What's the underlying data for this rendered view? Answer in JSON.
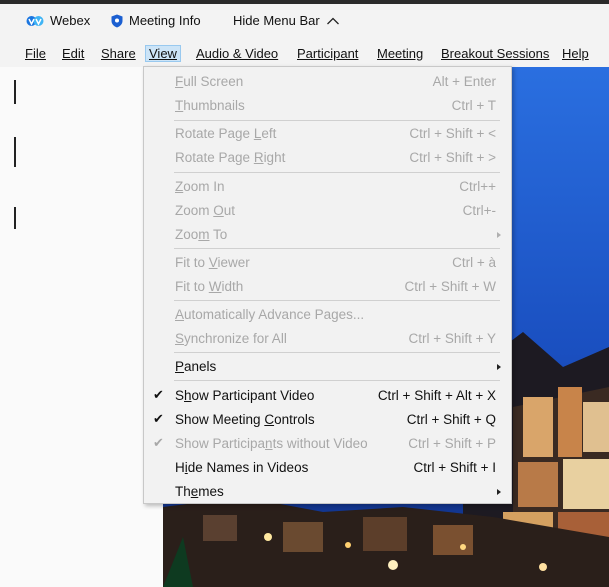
{
  "titlebar": {
    "app_name": "Webex",
    "meeting_info": "Meeting Info",
    "hide_menu_bar": "Hide Menu Bar"
  },
  "menubar": {
    "items": [
      "File",
      "Edit",
      "Share",
      "View",
      "Audio & Video",
      "Participant",
      "Meeting",
      "Breakout Sessions",
      "Help"
    ],
    "active": "View"
  },
  "view_menu": {
    "items": [
      {
        "pre": "",
        "u": "F",
        "post": "ull Screen",
        "shortcut": "Alt + Enter",
        "enabled": false
      },
      {
        "pre": "",
        "u": "T",
        "post": "humbnails",
        "shortcut": "Ctrl + T",
        "enabled": false
      },
      {
        "pre": "Rotate Page ",
        "u": "L",
        "post": "eft",
        "shortcut": "Ctrl + Shift + <",
        "enabled": false
      },
      {
        "pre": "Rotate Page ",
        "u": "R",
        "post": "ight",
        "shortcut": "Ctrl + Shift + >",
        "enabled": false
      },
      {
        "pre": "",
        "u": "Z",
        "post": "oom In",
        "shortcut": "Ctrl++",
        "enabled": false
      },
      {
        "pre": "Zoom ",
        "u": "O",
        "post": "ut",
        "shortcut": "Ctrl+-",
        "enabled": false
      },
      {
        "pre": "Zoo",
        "u": "m",
        "post": " To",
        "shortcut": "",
        "submenu": true,
        "enabled": false
      },
      {
        "pre": "Fit to ",
        "u": "V",
        "post": "iewer",
        "shortcut": "Ctrl + à",
        "enabled": false
      },
      {
        "pre": "Fit to ",
        "u": "W",
        "post": "idth",
        "shortcut": "Ctrl + Shift + W",
        "enabled": false
      },
      {
        "pre": "",
        "u": "A",
        "post": "utomatically Advance Pages...",
        "shortcut": "",
        "enabled": false
      },
      {
        "pre": "",
        "u": "S",
        "post": "ynchronize for All",
        "shortcut": "Ctrl + Shift + Y",
        "enabled": false
      },
      {
        "pre": "",
        "u": "P",
        "post": "anels",
        "shortcut": "",
        "submenu": true,
        "enabled": true
      },
      {
        "pre": "S",
        "u": "h",
        "post": "ow Participant Video",
        "shortcut": "Ctrl + Shift + Alt + X",
        "enabled": true,
        "checked": true
      },
      {
        "pre": "Show Meeting ",
        "u": "C",
        "post": "ontrols",
        "shortcut": "Ctrl + Shift + Q",
        "enabled": true,
        "checked": true
      },
      {
        "pre": "Show Participa",
        "u": "n",
        "post": "ts without Video",
        "shortcut": "Ctrl + Shift + P",
        "enabled": false,
        "checked": true
      },
      {
        "pre": "H",
        "u": "i",
        "post": "de Names in Videos",
        "shortcut": "Ctrl + Shift + I",
        "enabled": true
      },
      {
        "pre": "Th",
        "u": "e",
        "post": "mes",
        "shortcut": "",
        "submenu": true,
        "enabled": true
      }
    ],
    "check_glyph": "✔"
  },
  "colors": {
    "menu_bg": "#f2f2f2",
    "disabled_text": "#a8a8a8",
    "active_menu_bg": "#cce4f7",
    "webex_blue": "#0a6ed1"
  }
}
